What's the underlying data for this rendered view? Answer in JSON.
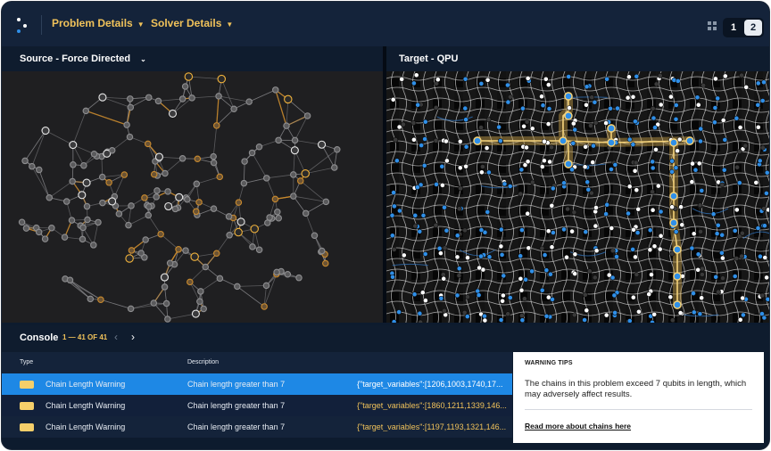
{
  "topbar": {
    "menus": [
      {
        "label": "Problem Details"
      },
      {
        "label": "Solver Details"
      }
    ],
    "pages": [
      "1",
      "2"
    ],
    "active_page": "1"
  },
  "panes": {
    "source": {
      "title": "Source - Force Directed"
    },
    "target": {
      "title": "Target - QPU"
    }
  },
  "console": {
    "title": "Console",
    "count": "1 — 41 OF 41",
    "columns": {
      "type": "Type",
      "description": "Description"
    },
    "rows": [
      {
        "type": "Chain Length Warning",
        "description": "Chain length greater than 7",
        "details": "{\"target_variables\":[1206,1003,1740,17..."
      },
      {
        "type": "Chain Length Warning",
        "description": "Chain length greater than 7",
        "details": "{\"target_variables\":[1860,1211,1339,146..."
      },
      {
        "type": "Chain Length Warning",
        "description": "Chain length greater than 7",
        "details": "{\"target_variables\":[1197,1193,1321,146..."
      }
    ]
  },
  "tips": {
    "title": "WARNING TIPS",
    "body": "The chains in this problem exceed 7 qubits in length, which may adversely affect results.",
    "link": "Read more about chains here"
  },
  "colors": {
    "accent": "#f0c25a",
    "selected_row": "#1e88e5",
    "qubit_blue": "#2f8fe8",
    "background": "#0d1b2e"
  },
  "icons": [
    "app-logo-icon",
    "chevron-down-icon",
    "layout-grid-icon",
    "chevron-left-icon",
    "chevron-right-icon",
    "warning-swatch-icon"
  ]
}
